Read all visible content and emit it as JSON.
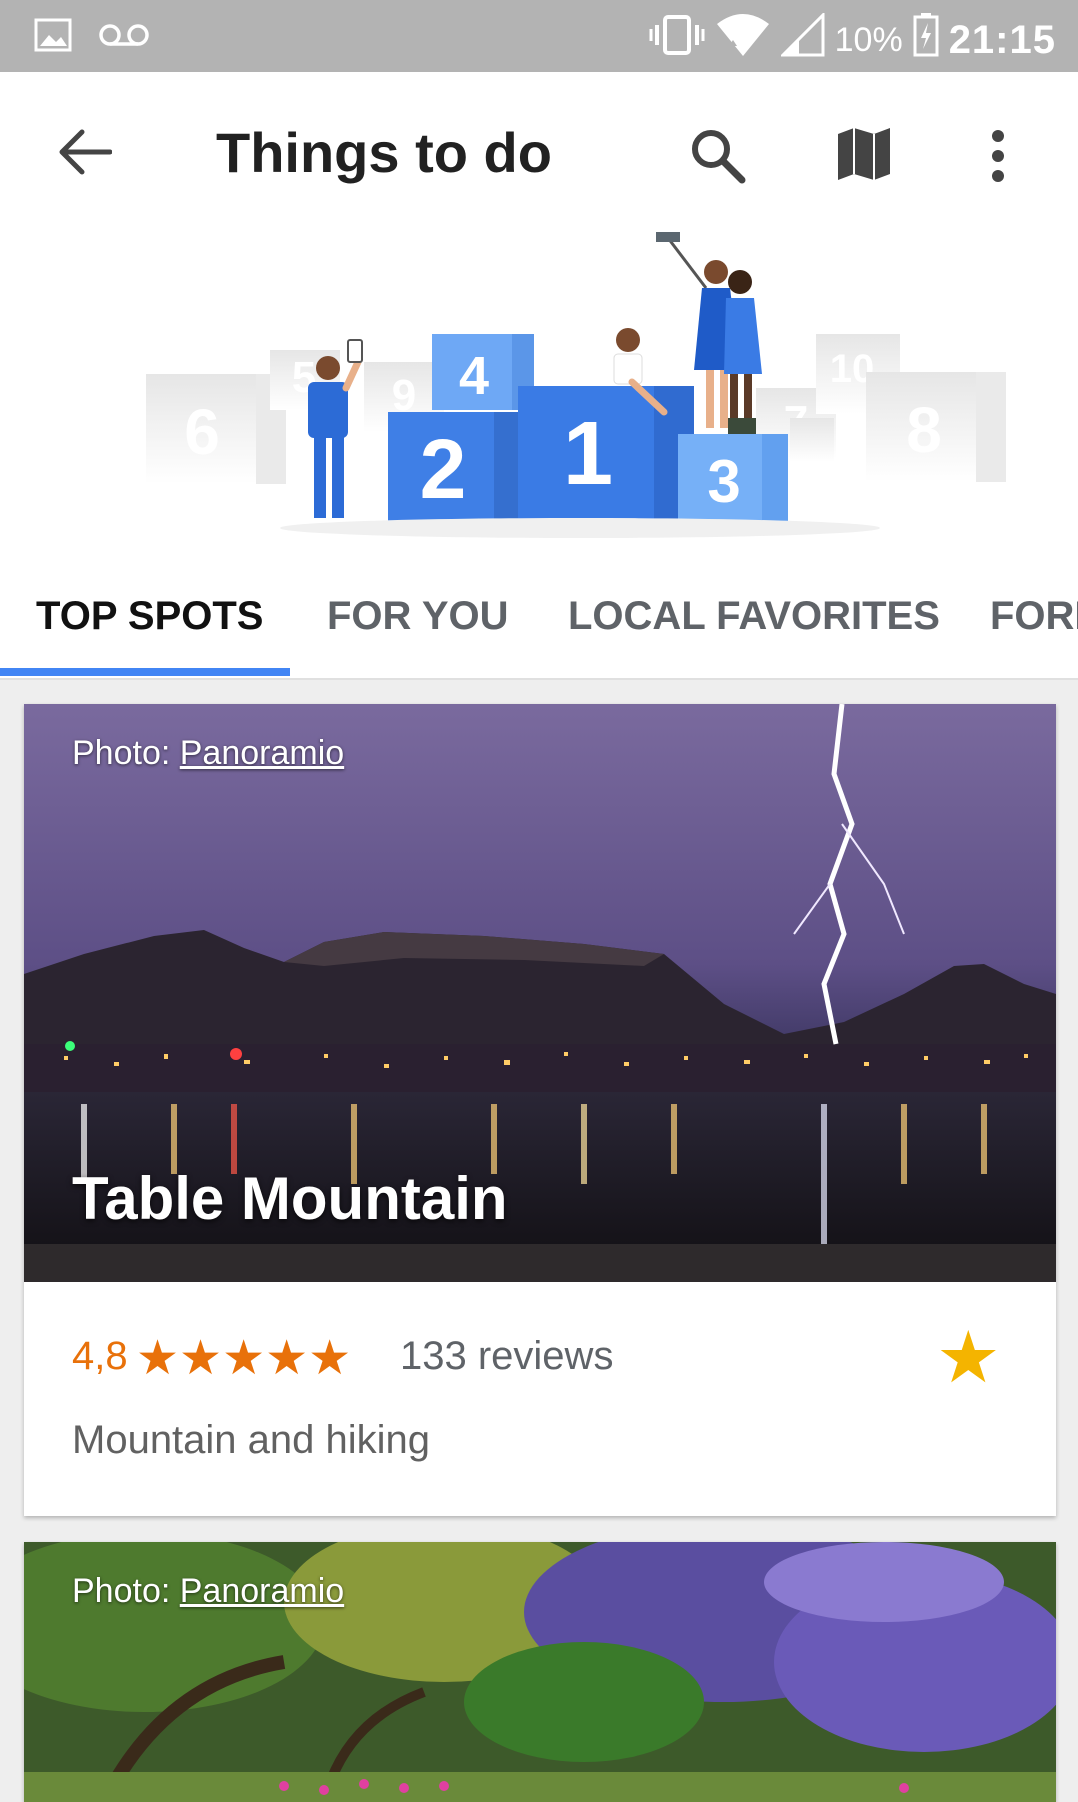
{
  "status_bar": {
    "battery": "10%",
    "time": "21:15"
  },
  "app_bar": {
    "title": "Things to do"
  },
  "tabs": [
    {
      "label": "TOP SPOTS",
      "active": true
    },
    {
      "label": "FOR YOU",
      "active": false
    },
    {
      "label": "LOCAL FAVORITES",
      "active": false
    },
    {
      "label": "FORE",
      "active": false
    }
  ],
  "hero": {
    "podium_numbers": [
      "6",
      "5",
      "9",
      "4",
      "2",
      "1",
      "3",
      "7",
      "10",
      "8"
    ]
  },
  "cards": [
    {
      "photo_credit_prefix": "Photo: ",
      "photo_credit_link": "Panoramio",
      "name": "Table Mountain",
      "rating": "4,8",
      "stars": "★★★★★",
      "reviews": "133 reviews",
      "category": "Mountain and hiking"
    },
    {
      "photo_credit_prefix": "Photo: ",
      "photo_credit_link": "Panoramio"
    }
  ],
  "colors": {
    "accent": "#4285f4",
    "rating": "#e8710a",
    "save_star": "#f4b400"
  }
}
